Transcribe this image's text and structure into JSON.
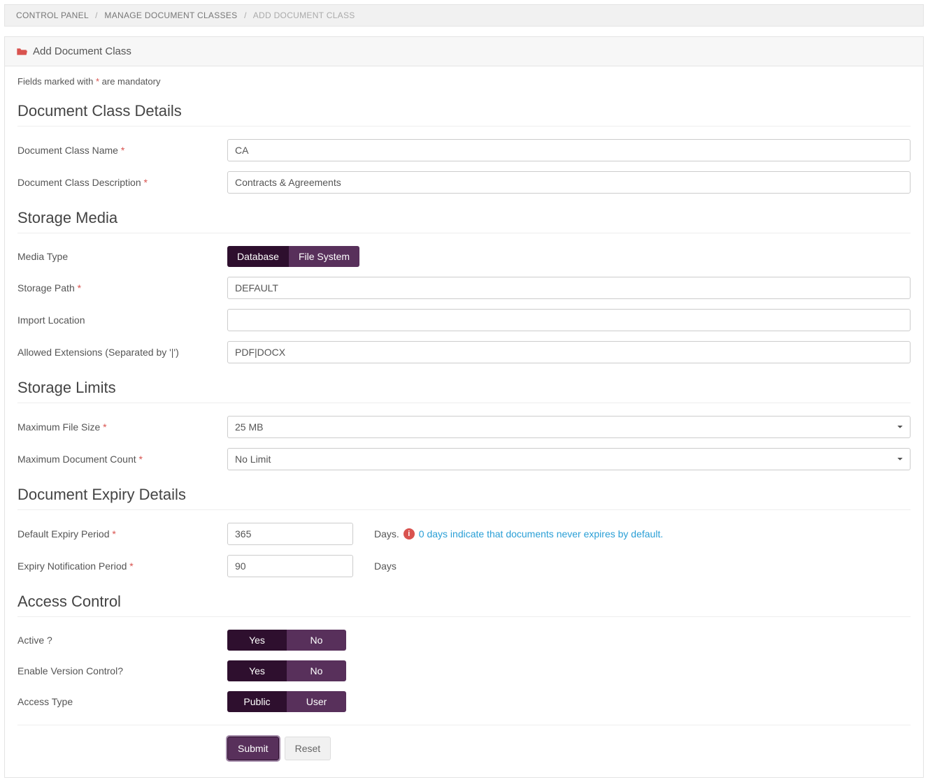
{
  "breadcrumb": {
    "item1": "CONTROL PANEL",
    "item2": "MANAGE DOCUMENT CLASSES",
    "item3": "ADD DOCUMENT CLASS"
  },
  "panel": {
    "title": "Add Document Class"
  },
  "mandatory_note_prefix": "Fields marked with ",
  "mandatory_note_mark": "*",
  "mandatory_note_suffix": " are mandatory",
  "sections": {
    "details": "Document Class Details",
    "storage": "Storage Media",
    "limits": "Storage Limits",
    "expiry": "Document Expiry Details",
    "access": "Access Control"
  },
  "labels": {
    "class_name": "Document Class Name ",
    "class_desc": "Document Class Description ",
    "media_type": "Media Type",
    "storage_path": "Storage Path ",
    "import_location": "Import Location",
    "allowed_ext": "Allowed Extensions (Separated by '|')",
    "max_file_size": "Maximum File Size ",
    "max_doc_count": "Maximum Document Count ",
    "default_expiry": "Default Expiry Period ",
    "expiry_notify": "Expiry Notification Period ",
    "active": "Active ?",
    "version_control": "Enable Version Control?",
    "access_type": "Access Type",
    "req": "*"
  },
  "values": {
    "class_name": "CA",
    "class_desc": "Contracts & Agreements",
    "storage_path": "DEFAULT",
    "import_location": "",
    "allowed_ext": "PDF|DOCX",
    "max_file_size": "25 MB",
    "max_doc_count": "No Limit",
    "default_expiry": "365",
    "expiry_notify": "90"
  },
  "toggles": {
    "media_database": "Database",
    "media_filesystem": "File System",
    "yes": "Yes",
    "no": "No",
    "public": "Public",
    "user": "User"
  },
  "hints": {
    "days_label": "Days.",
    "days_plain": "Days",
    "expiry_info": "0 days indicate that documents never expires by default."
  },
  "buttons": {
    "submit": "Submit",
    "reset": "Reset"
  }
}
